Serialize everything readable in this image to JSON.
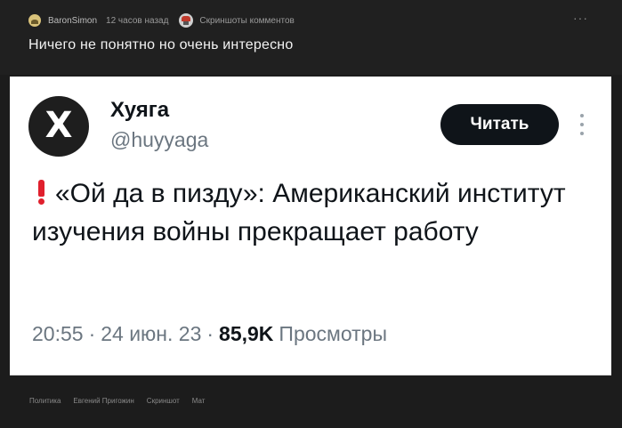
{
  "post": {
    "author": "BaronSimon",
    "time": "12 часов назад",
    "community": "Скриншоты комментов",
    "more_glyph": "···",
    "title": "Ничего не понятно но очень интересно"
  },
  "tweet": {
    "avatar_glyph": "X",
    "name": "Хуяга",
    "handle": "@huyyaga",
    "follow_label": "Читать",
    "text": "«Ой да в пизду»: Американский институт изучения войны прекращает работу",
    "time": "20:55",
    "date": "24 июн. 23",
    "views_count": "85,9K",
    "views_label": "Просмотры",
    "separator": "·"
  },
  "tags": [
    "Политика",
    "Евгений Пригожин",
    "Скриншот",
    "Мат"
  ],
  "icons": {
    "author_avatar": "avatar",
    "community": "community-icon",
    "warning": "exclamation-icon"
  }
}
